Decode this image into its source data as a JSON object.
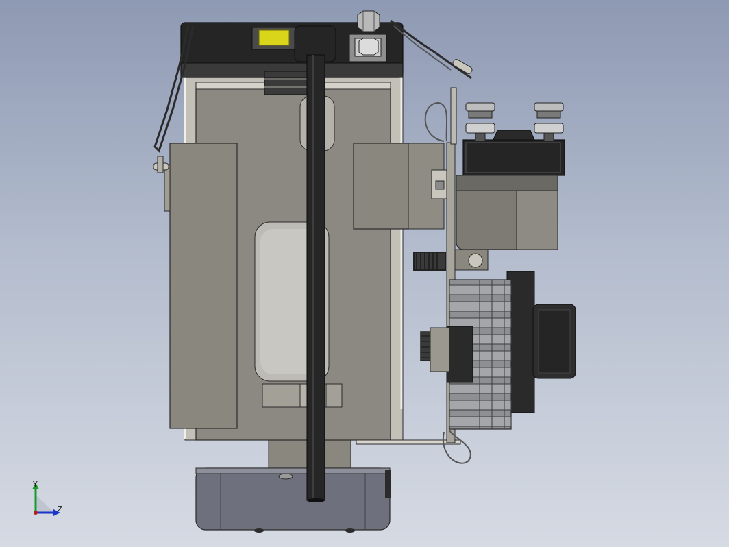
{
  "viewport": {
    "background_top": "#8e99b3",
    "background_bottom": "#d6dae3"
  },
  "triad": {
    "y_label": "Y",
    "z_label": "Z",
    "y_color": "#1a9a2a",
    "z_color": "#1b36c8"
  },
  "colors": {
    "housing": "#8c8982",
    "housing_dark": "#5c5a56",
    "plate_metal": "#a8a59d",
    "black_part": "#252525",
    "dark_grey": "#3b3b3b",
    "yellow_window": "#d8d51a",
    "base_tray": "#6e717d",
    "motor_grey": "#7e7b74",
    "edge": "#2a2a2a"
  },
  "icons": {
    "hex_nut": "hex-nut-icon",
    "spring": "spring-icon",
    "clip": "wire-clip-icon"
  }
}
